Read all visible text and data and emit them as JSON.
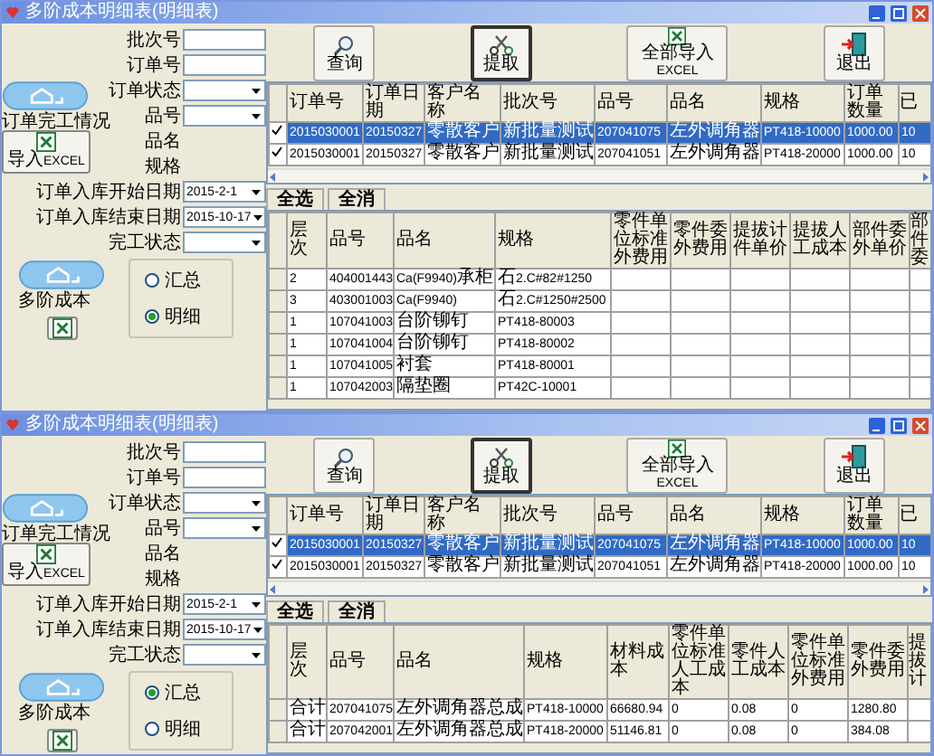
{
  "windows": [
    {
      "title": "多阶成本明细表(明细表)",
      "fields": [
        {
          "label": "批次号",
          "kind": "text"
        },
        {
          "label": "订单号",
          "kind": "text"
        },
        {
          "label": "订单状态",
          "kind": "select"
        },
        {
          "label": "品号",
          "kind": "select"
        },
        {
          "label": "品名",
          "kind": "label"
        },
        {
          "label": "规格",
          "kind": "label"
        },
        {
          "label": "订单入库开始日期",
          "kind": "date",
          "value": "2015-2-1"
        },
        {
          "label": "订单入库结束日期",
          "kind": "date",
          "value": "2015-10-17"
        },
        {
          "label": "完工状态",
          "kind": "select"
        }
      ],
      "side_buttons": [
        {
          "label": "订单完工情况",
          "kind": "cloud"
        },
        {
          "label": "导入EXCEL",
          "kind": "excel"
        },
        {
          "label": "多阶成本",
          "kind": "cloud"
        },
        {
          "kind": "excel"
        }
      ],
      "mode": [
        {
          "label": "汇总",
          "selected": false
        },
        {
          "label": "明细",
          "selected": true
        }
      ],
      "toolbar": [
        {
          "label": "查询",
          "kind": "search",
          "focused": false
        },
        {
          "label": "提取",
          "kind": "pick",
          "focused": true
        },
        {
          "label": "全部导入EXCEL",
          "kind": "excel",
          "focused": false
        },
        {
          "label": "退出",
          "kind": "exit",
          "focused": false
        }
      ],
      "orders": {
        "columns": [
          "订单号",
          "订单日期",
          "客户名称",
          "批次号",
          "品号",
          "品名",
          "规格",
          "订单数量",
          "已"
        ],
        "rows": [
          {
            "checked": true,
            "selected": true,
            "cells": [
              "2015030001",
              "20150327",
              "零散客户",
              "新批量测试",
              "207041075",
              "左外调角器",
              "PT418-10000",
              "1000.00",
              "10"
            ]
          },
          {
            "checked": true,
            "selected": false,
            "cells": [
              "2015030001",
              "20150327",
              "零散客户",
              "新批量测试",
              "207041051",
              "左外调角器",
              "PT418-20000",
              "1000.00",
              "10"
            ]
          }
        ]
      },
      "select_buttons": [
        "全选",
        "全消"
      ],
      "detail": {
        "columns": [
          "层次",
          "品号",
          "品名",
          "规格",
          "零件单位标准外费用",
          "零件委外费用",
          "提拔计件单价",
          "提拔人工成本",
          "部件委外单价",
          "部件委"
        ],
        "rows": [
          [
            "2",
            "404001443",
            "Ca(F9940)承柜",
            "石2.C#82#1250"
          ],
          [
            "3",
            "403001003",
            "Ca(F9940)",
            "石2.C#1250#2500"
          ],
          [
            "1",
            "107041003",
            "台阶铆钉",
            "PT418-80003"
          ],
          [
            "1",
            "107041004",
            "台阶铆钉",
            "PT418-80002"
          ],
          [
            "1",
            "107041005",
            "衬套",
            "PT418-80001"
          ],
          [
            "1",
            "107042003",
            "隔垫圈",
            "PT42C-10001"
          ]
        ]
      }
    },
    {
      "title": "多阶成本明细表(明细表)",
      "fields": [
        {
          "label": "批次号",
          "kind": "text"
        },
        {
          "label": "订单号",
          "kind": "text"
        },
        {
          "label": "订单状态",
          "kind": "select"
        },
        {
          "label": "品号",
          "kind": "select"
        },
        {
          "label": "品名",
          "kind": "label"
        },
        {
          "label": "规格",
          "kind": "label"
        },
        {
          "label": "订单入库开始日期",
          "kind": "date",
          "value": "2015-2-1"
        },
        {
          "label": "订单入库结束日期",
          "kind": "date",
          "value": "2015-10-17"
        },
        {
          "label": "完工状态",
          "kind": "select"
        }
      ],
      "side_buttons": [
        {
          "label": "订单完工情况",
          "kind": "cloud"
        },
        {
          "label": "导入EXCEL",
          "kind": "excel"
        },
        {
          "label": "多阶成本",
          "kind": "cloud"
        },
        {
          "kind": "excel"
        }
      ],
      "mode": [
        {
          "label": "汇总",
          "selected": true
        },
        {
          "label": "明细",
          "selected": false
        }
      ],
      "toolbar": [
        {
          "label": "查询",
          "kind": "search",
          "focused": false
        },
        {
          "label": "提取",
          "kind": "pick",
          "focused": true
        },
        {
          "label": "全部导入EXCEL",
          "kind": "excel",
          "focused": false
        },
        {
          "label": "退出",
          "kind": "exit",
          "focused": false
        }
      ],
      "orders": {
        "columns": [
          "订单号",
          "订单日期",
          "客户名称",
          "批次号",
          "品号",
          "品名",
          "规格",
          "订单数量",
          "已"
        ],
        "rows": [
          {
            "checked": true,
            "selected": true,
            "cells": [
              "2015030001",
              "20150327",
              "零散客户",
              "新批量测试",
              "207041075",
              "左外调角器",
              "PT418-10000",
              "1000.00",
              "10"
            ]
          },
          {
            "checked": true,
            "selected": false,
            "cells": [
              "2015030001",
              "20150327",
              "零散客户",
              "新批量测试",
              "207041051",
              "左外调角器",
              "PT418-20000",
              "1000.00",
              "10"
            ]
          }
        ]
      },
      "select_buttons": [
        "全选",
        "全消"
      ],
      "detail": {
        "columns": [
          "层次",
          "品号",
          "品名",
          "规格",
          "材料成本",
          "零件单位标准人工成本",
          "零件人工成本",
          "零件单位标准外费用",
          "零件委外费用",
          "提拔计"
        ],
        "rows": [
          [
            "合计",
            "207041075",
            "左外调角器总成",
            "PT418-10000",
            "66680.94",
            "0",
            "0.08",
            "0",
            "1280.80"
          ],
          [
            "合计",
            "207042001",
            "左外调角器总成",
            "PT418-20000",
            "51146.81",
            "0",
            "0.08",
            "0",
            "384.08"
          ]
        ]
      }
    }
  ]
}
